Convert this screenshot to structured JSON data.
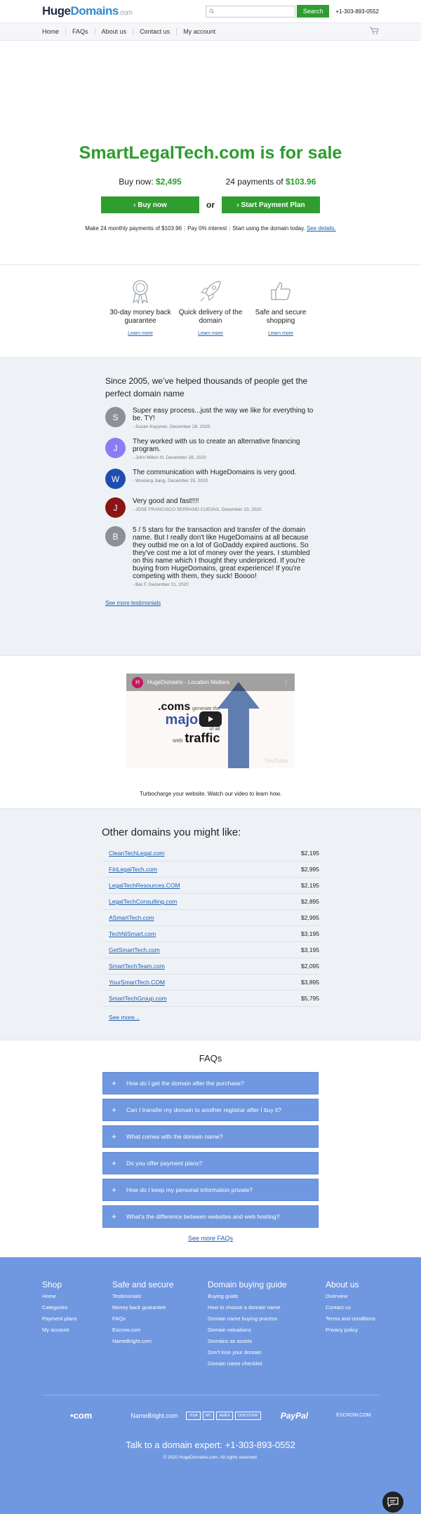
{
  "header": {
    "logo": {
      "huge": "Huge",
      "domains": "Domains",
      "com": ".com"
    },
    "search": {
      "placeholder": "",
      "button": "Search"
    },
    "phone": "+1-303-893-0552"
  },
  "nav": [
    "Home",
    "FAQs",
    "About us",
    "Contact us",
    "My account"
  ],
  "hero": {
    "title": "SmartLegalTech.com is for sale",
    "buy_now_label": "Buy now:",
    "buy_now_price": "$2,495",
    "payments_label": "24 payments of",
    "payments_price": "$103.96",
    "buy_button": "› Buy now",
    "or": "or",
    "plan_button": "› Start Payment Plan",
    "terms": [
      "Make 24 monthly payments of $103.96",
      "Pay 0% interest",
      "Start using the domain today."
    ],
    "details_link": "See details."
  },
  "features": [
    {
      "icon": "medal-icon",
      "text": "30-day money back guarantee",
      "link": "Learn more"
    },
    {
      "icon": "rocket-icon",
      "text": "Quick delivery of the domain",
      "link": "Learn more"
    },
    {
      "icon": "thumbs-up-icon",
      "text": "Safe and secure shopping",
      "link": "Learn more"
    }
  ],
  "testimonials": {
    "heading": "Since 2005, we’ve helped thousands of people get the perfect domain name",
    "items": [
      {
        "initial": "S",
        "color": "#8c9197",
        "text": "Super easy process...just the way we like for everything to be. TY!",
        "author": "- Susan Kopynec, December 28, 2020"
      },
      {
        "initial": "J",
        "color": "#8b7cf6",
        "text": "They worked with us to create an alternative financing program.",
        "author": "- John Millen III, December 28, 2020"
      },
      {
        "initial": "W",
        "color": "#1e4fb0",
        "text": "The communication with HugeDomains is very good.",
        "author": "- Wuxiang Jiang, December 25, 2020"
      },
      {
        "initial": "J",
        "color": "#8b1414",
        "text": "Very good and fast!!!!",
        "author": "- JOSE FRANCISCO SERRANO CUEVAS, December 23, 2020"
      },
      {
        "initial": "B",
        "color": "#8c9197",
        "text": "5 / 5 stars for the transaction and transfer of the domain name. But I really don't like HugeDomains at all because they outbid me on a lot of GoDaddy expired auctions. So they've cost me a lot of money over the years. I stumbled on this name which I thought they underpriced. If you're buying from HugeDomains, great experience! If you're competing with them, they suck! Boooo!",
        "author": "- Bar F, December 21, 2020"
      }
    ],
    "more": "See more testimonials"
  },
  "video": {
    "channel_initial": "H",
    "title": "HugeDomains - Location Matters",
    "line1": ".coms",
    "line1b": "generate the",
    "line2": "majority",
    "line3": "of all",
    "line4": "web",
    "line5": "traffic",
    "yt": "YouTube",
    "caption": "Turbocharge your website. Watch our video to learn how."
  },
  "others": {
    "heading": "Other domains you might like:",
    "domains": [
      {
        "name": "CleanTechLegal.com",
        "price": "$2,195"
      },
      {
        "name": "FinLegalTech.com",
        "price": "$2,995"
      },
      {
        "name": "LegalTechResources.COM",
        "price": "$2,195"
      },
      {
        "name": "LegalTechConsulting.com",
        "price": "$2,895"
      },
      {
        "name": "ASmartTech.com",
        "price": "$2,995"
      },
      {
        "name": "TechNiSmart.com",
        "price": "$3,195"
      },
      {
        "name": "GetSmartTech.com",
        "price": "$3,195"
      },
      {
        "name": "SmartTechTeam.com",
        "price": "$2,095"
      },
      {
        "name": "YourSmartTech.COM",
        "price": "$3,895"
      },
      {
        "name": "SmartTechGroup.com",
        "price": "$5,795"
      }
    ],
    "more": "See more..."
  },
  "faqs": {
    "heading": "FAQs",
    "items": [
      "How do I get the domain after the purchase?",
      "Can I transfer my domain to another registrar after I buy it?",
      "What comes with the domain name?",
      "Do you offer payment plans?",
      "How do I keep my personal information private?",
      "What’s the difference between websites and web hosting?"
    ],
    "more": "See more FAQs"
  },
  "footer": {
    "columns": [
      {
        "title": "Shop",
        "links": [
          "Home",
          "Categories",
          "Payment plans",
          "My account"
        ]
      },
      {
        "title": "Safe and secure",
        "links": [
          "Testimonials",
          "Money back guarantee",
          "FAQs",
          "Escrow.com",
          "NameBright.com"
        ]
      },
      {
        "title": "Domain buying guide",
        "links": [
          "Buying guide",
          "How to choose a domain name",
          "Domain name buying process",
          "Domain valuations",
          "Domains as assets",
          "Don't lose your domain",
          "Domain name checklist"
        ]
      },
      {
        "title": "About us",
        "links": [
          "Overview",
          "Contact us",
          "Terms and conditions",
          "Privacy policy"
        ]
      }
    ],
    "partners": {
      "dotcom": "•com",
      "namebright": "NameBright.com",
      "cards": [
        "VISA",
        "MC",
        "AMEX",
        "DISCOVER"
      ],
      "paypal": "PayPal",
      "escrow": "ESCROW.COM"
    },
    "talk": "Talk to a domain expert: +1-303-893-0552",
    "copyright": "© 2020 HugeDomains.com. All rights reserved."
  }
}
